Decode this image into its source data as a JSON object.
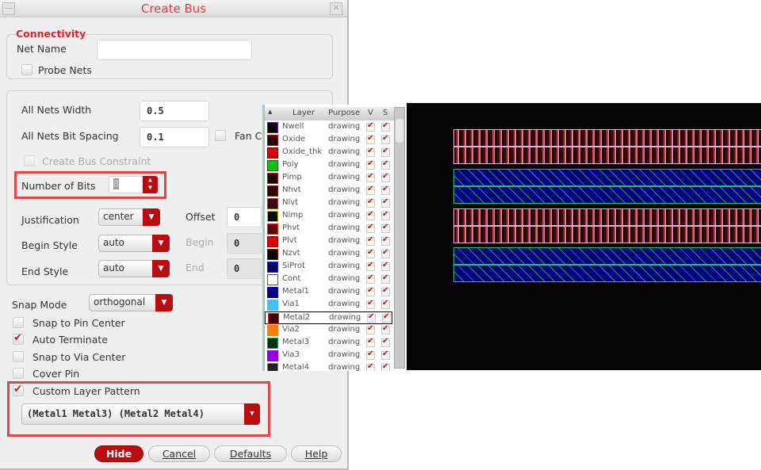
{
  "dialog": {
    "title": "Create Bus",
    "connectivity": {
      "legend": "Connectivity",
      "net_name_label": "Net Name",
      "net_name_value": "",
      "probe_nets_label": "Probe Nets",
      "probe_nets_checked": false
    },
    "width_label": "All Nets Width",
    "width_value": "0.5",
    "spacing_label": "All Nets Bit Spacing",
    "spacing_value": "0.1",
    "fan_label": "Fan C",
    "fan_checked": false,
    "constraint_label": "Create Bus Constraint",
    "bits_label": "Number of Bits",
    "bits_value": "8",
    "justification_label": "Justification",
    "justification_value": "center",
    "offset_label": "Offset",
    "offset_value": "0",
    "begin_style_label": "Begin Style",
    "begin_style_value": "auto",
    "begin_label": "Begin",
    "begin_value": "0",
    "end_style_label": "End Style",
    "end_style_value": "auto",
    "end_label": "End",
    "end_value": "0",
    "snap_mode_label": "Snap Mode",
    "snap_mode_value": "orthogonal",
    "options": [
      {
        "label": "Snap to Pin Center",
        "checked": false
      },
      {
        "label": "Auto Terminate",
        "checked": true
      },
      {
        "label": "Snap to Via Center",
        "checked": false
      },
      {
        "label": "Cover Pin",
        "checked": false
      },
      {
        "label": "Custom Layer Pattern",
        "checked": true
      }
    ],
    "pattern_value": "(Metal1 Metal3) (Metal2 Metal4)",
    "buttons": {
      "hide": "Hide",
      "cancel": "Cancel",
      "defaults": "Defaults",
      "help": "Help"
    }
  },
  "layers": {
    "headers": {
      "layer": "Layer",
      "purpose": "Purpose",
      "v": "V",
      "s": "S"
    },
    "rows": [
      {
        "name": "Nwell",
        "purpose": "drawing",
        "color": "#000000",
        "border": "#6020a0"
      },
      {
        "name": "Oxide",
        "purpose": "drawing",
        "color": "#300000",
        "border": "#a01010"
      },
      {
        "name": "Oxide_thk",
        "purpose": "drawing",
        "color": "#e00000",
        "border": "#600"
      },
      {
        "name": "Poly",
        "purpose": "drawing",
        "color": "#10c010",
        "border": "#060"
      },
      {
        "name": "Pimp",
        "purpose": "drawing",
        "color": "#200000",
        "border": "#a02020"
      },
      {
        "name": "Nhvt",
        "purpose": "drawing",
        "color": "#300000",
        "border": "#802020"
      },
      {
        "name": "Nlvt",
        "purpose": "drawing",
        "color": "#400808",
        "border": "#a04040"
      },
      {
        "name": "Nimp",
        "purpose": "drawing",
        "color": "#000000",
        "border": "#c0c000"
      },
      {
        "name": "Phvt",
        "purpose": "drawing",
        "color": "#600000",
        "border": "#e02020"
      },
      {
        "name": "Plvt",
        "purpose": "drawing",
        "color": "#e00000",
        "border": "#800"
      },
      {
        "name": "Nzvt",
        "purpose": "drawing",
        "color": "#000000",
        "border": "#a00000"
      },
      {
        "name": "SiProt",
        "purpose": "drawing",
        "color": "#000060",
        "border": "#2020e0"
      },
      {
        "name": "Cont",
        "purpose": "drawing",
        "color": "#ffffff",
        "border": "#555"
      },
      {
        "name": "Metal1",
        "purpose": "drawing",
        "color": "#000080",
        "border": "#0000c0"
      },
      {
        "name": "Via1",
        "purpose": "drawing",
        "color": "#40c0ff",
        "border": "#40c0ff"
      },
      {
        "name": "Metal2",
        "purpose": "drawing",
        "color": "#400000",
        "border": "#e02020",
        "selected": true
      },
      {
        "name": "Via2",
        "purpose": "drawing",
        "color": "#ff8000",
        "border": "#ff8000"
      },
      {
        "name": "Metal3",
        "purpose": "drawing",
        "color": "#003010",
        "border": "#20a060"
      },
      {
        "name": "Via3",
        "purpose": "drawing",
        "color": "#9000e0",
        "border": "#9000e0"
      },
      {
        "name": "Metal4",
        "purpose": "drawing",
        "color": "#202020",
        "border": "#888"
      }
    ]
  },
  "canvas": {
    "buses": [
      {
        "layer": "Metal2",
        "style": "pink"
      },
      {
        "layer": "Metal1",
        "style": "green"
      },
      {
        "layer": "Metal2",
        "style": "pink"
      },
      {
        "layer": "Metal1",
        "style": "green"
      }
    ]
  }
}
